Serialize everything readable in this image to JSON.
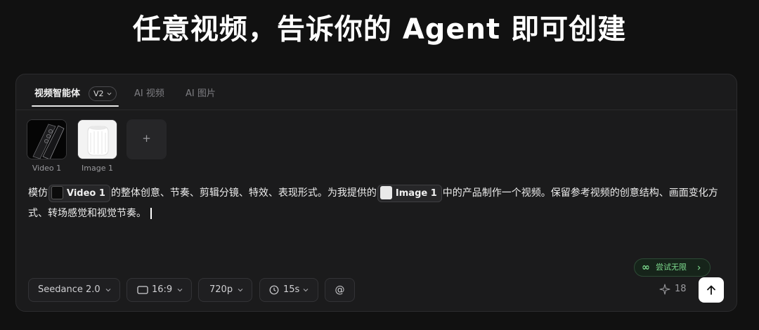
{
  "headline": "任意视频，告诉你的 Agent 即可创建",
  "tabs": {
    "agent": "视频智能体",
    "version": "V2",
    "ai_video": "AI 视频",
    "ai_image": "AI 图片"
  },
  "attachments": {
    "video_caption": "Video 1",
    "image_caption": "Image 1",
    "add_label": "+"
  },
  "prompt": {
    "part1": "模仿",
    "video_ref": "Video 1",
    "part2": "的整体创意、节奏、剪辑分镜、特效、表现形式。为我提供的",
    "image_ref": "Image 1",
    "part3": "中的产品制作一个视频。保留参考视频的创意结构、画面变化方式、转场感觉和视觉节奏。"
  },
  "try_badge": {
    "icon": "∞",
    "label": "尝试无限"
  },
  "toolbar": {
    "model": "Seedance 2.0",
    "ratio": "16:9",
    "resolution": "720p",
    "duration": "15s",
    "mention": "@",
    "credits": "18"
  },
  "colors": {
    "background": "#111111",
    "panel": "#1b1b1c",
    "accent_green": "#7edc8f",
    "send_button": "#ffffff"
  },
  "icons": {
    "ratio": "aspect-ratio-icon",
    "duration": "clock-icon",
    "credits": "sparkle-icon",
    "send": "arrow-up-icon"
  }
}
